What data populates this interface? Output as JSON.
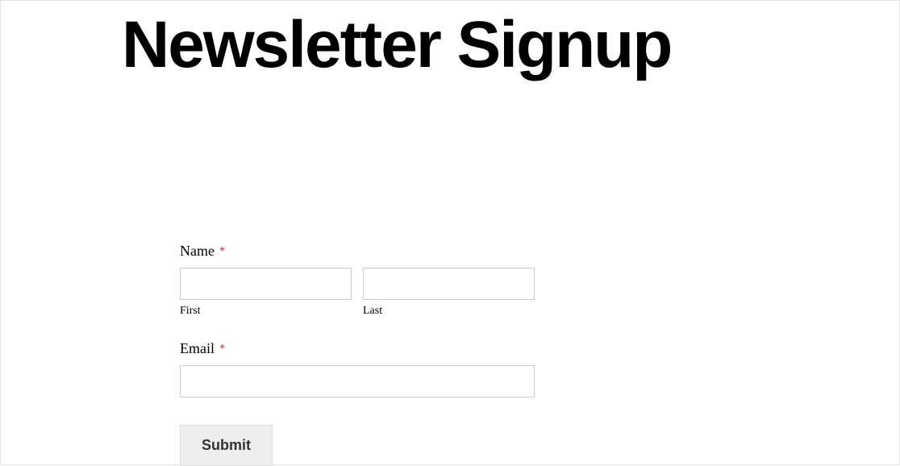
{
  "header": {
    "title": "Newsletter Signup"
  },
  "form": {
    "name": {
      "label": "Name",
      "required_mark": "*",
      "first": {
        "sublabel": "First",
        "value": ""
      },
      "last": {
        "sublabel": "Last",
        "value": ""
      }
    },
    "email": {
      "label": "Email",
      "required_mark": "*",
      "value": ""
    },
    "submit": {
      "label": "Submit"
    }
  }
}
